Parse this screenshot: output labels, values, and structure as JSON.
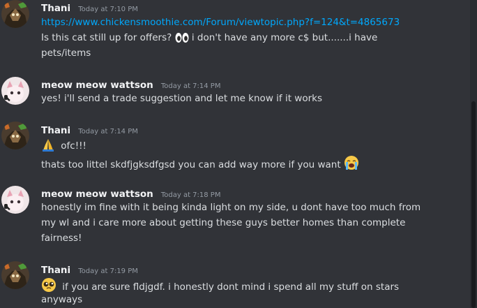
{
  "messages": [
    {
      "author": "Thani",
      "timestamp": "Today at 7:10 PM",
      "link": "https://www.chickensmoothie.com/Forum/viewtopic.php?f=124&t=4865673",
      "line1_a": "Is this cat still up for offers?",
      "line1_b": "i don't have any more c$ but.......i have",
      "line2": "pets/items"
    },
    {
      "author": "meow meow wattson",
      "timestamp": "Today at 7:14 PM",
      "line1": "yes! i'll send a trade suggestion and let me know if it works"
    },
    {
      "author": "Thani",
      "timestamp": "Today at 7:14 PM",
      "line1": "ofc!!!",
      "line2": "thats too littel skdfjgksdfgsd you can add way more if you want"
    },
    {
      "author": "meow meow wattson",
      "timestamp": "Today at 7:18 PM",
      "line1": "honestly im fine with it being kinda light on my side, u dont have too much from",
      "line2": "my wl and i care more about getting these guys better homes than complete",
      "line3": "fairness!"
    },
    {
      "author": "Thani",
      "timestamp": "Today at 7:19 PM",
      "line1": "if you are sure fldjgdf. i honestly dont mind  i spend all my stuff on stars",
      "line2": "anyways"
    }
  ],
  "colors": {
    "background": "#313338",
    "author": "#f2f3f5",
    "text": "#dbdee1",
    "timestamp": "#949ba4",
    "link": "#00a8fc"
  },
  "icons": [
    "eyes-emoji",
    "folded-hands-emoji",
    "loudly-crying-emoji",
    "pleading-face-emoji",
    "avatar-thani",
    "avatar-meow"
  ]
}
